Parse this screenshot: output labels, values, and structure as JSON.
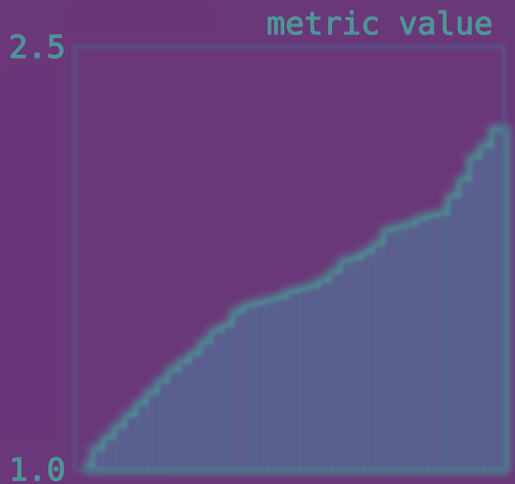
{
  "chart_data": {
    "type": "area",
    "title": "metric value",
    "xlabel": "",
    "ylabel": "",
    "ylim": [
      1.0,
      2.5
    ],
    "yticks": [
      "2.5",
      "1.0"
    ],
    "grid": false,
    "series": [
      {
        "values": [
          1.0,
          1.06,
          1.1,
          1.14,
          1.18,
          1.22,
          1.26,
          1.3,
          1.34,
          1.37,
          1.4,
          1.44,
          1.48,
          1.5,
          1.55,
          1.57,
          1.58,
          1.59,
          1.6,
          1.62,
          1.63,
          1.64,
          1.66,
          1.69,
          1.73,
          1.74,
          1.76,
          1.79,
          1.84,
          1.85,
          1.86,
          1.88,
          1.89,
          1.9,
          1.96,
          2.02,
          2.1,
          2.14,
          2.2
        ]
      }
    ],
    "colors": {
      "background": "#6a3779",
      "fill": "#59628f",
      "edge": "#4a9a96",
      "axis": "#46698a",
      "text": "#3f9a92"
    }
  }
}
